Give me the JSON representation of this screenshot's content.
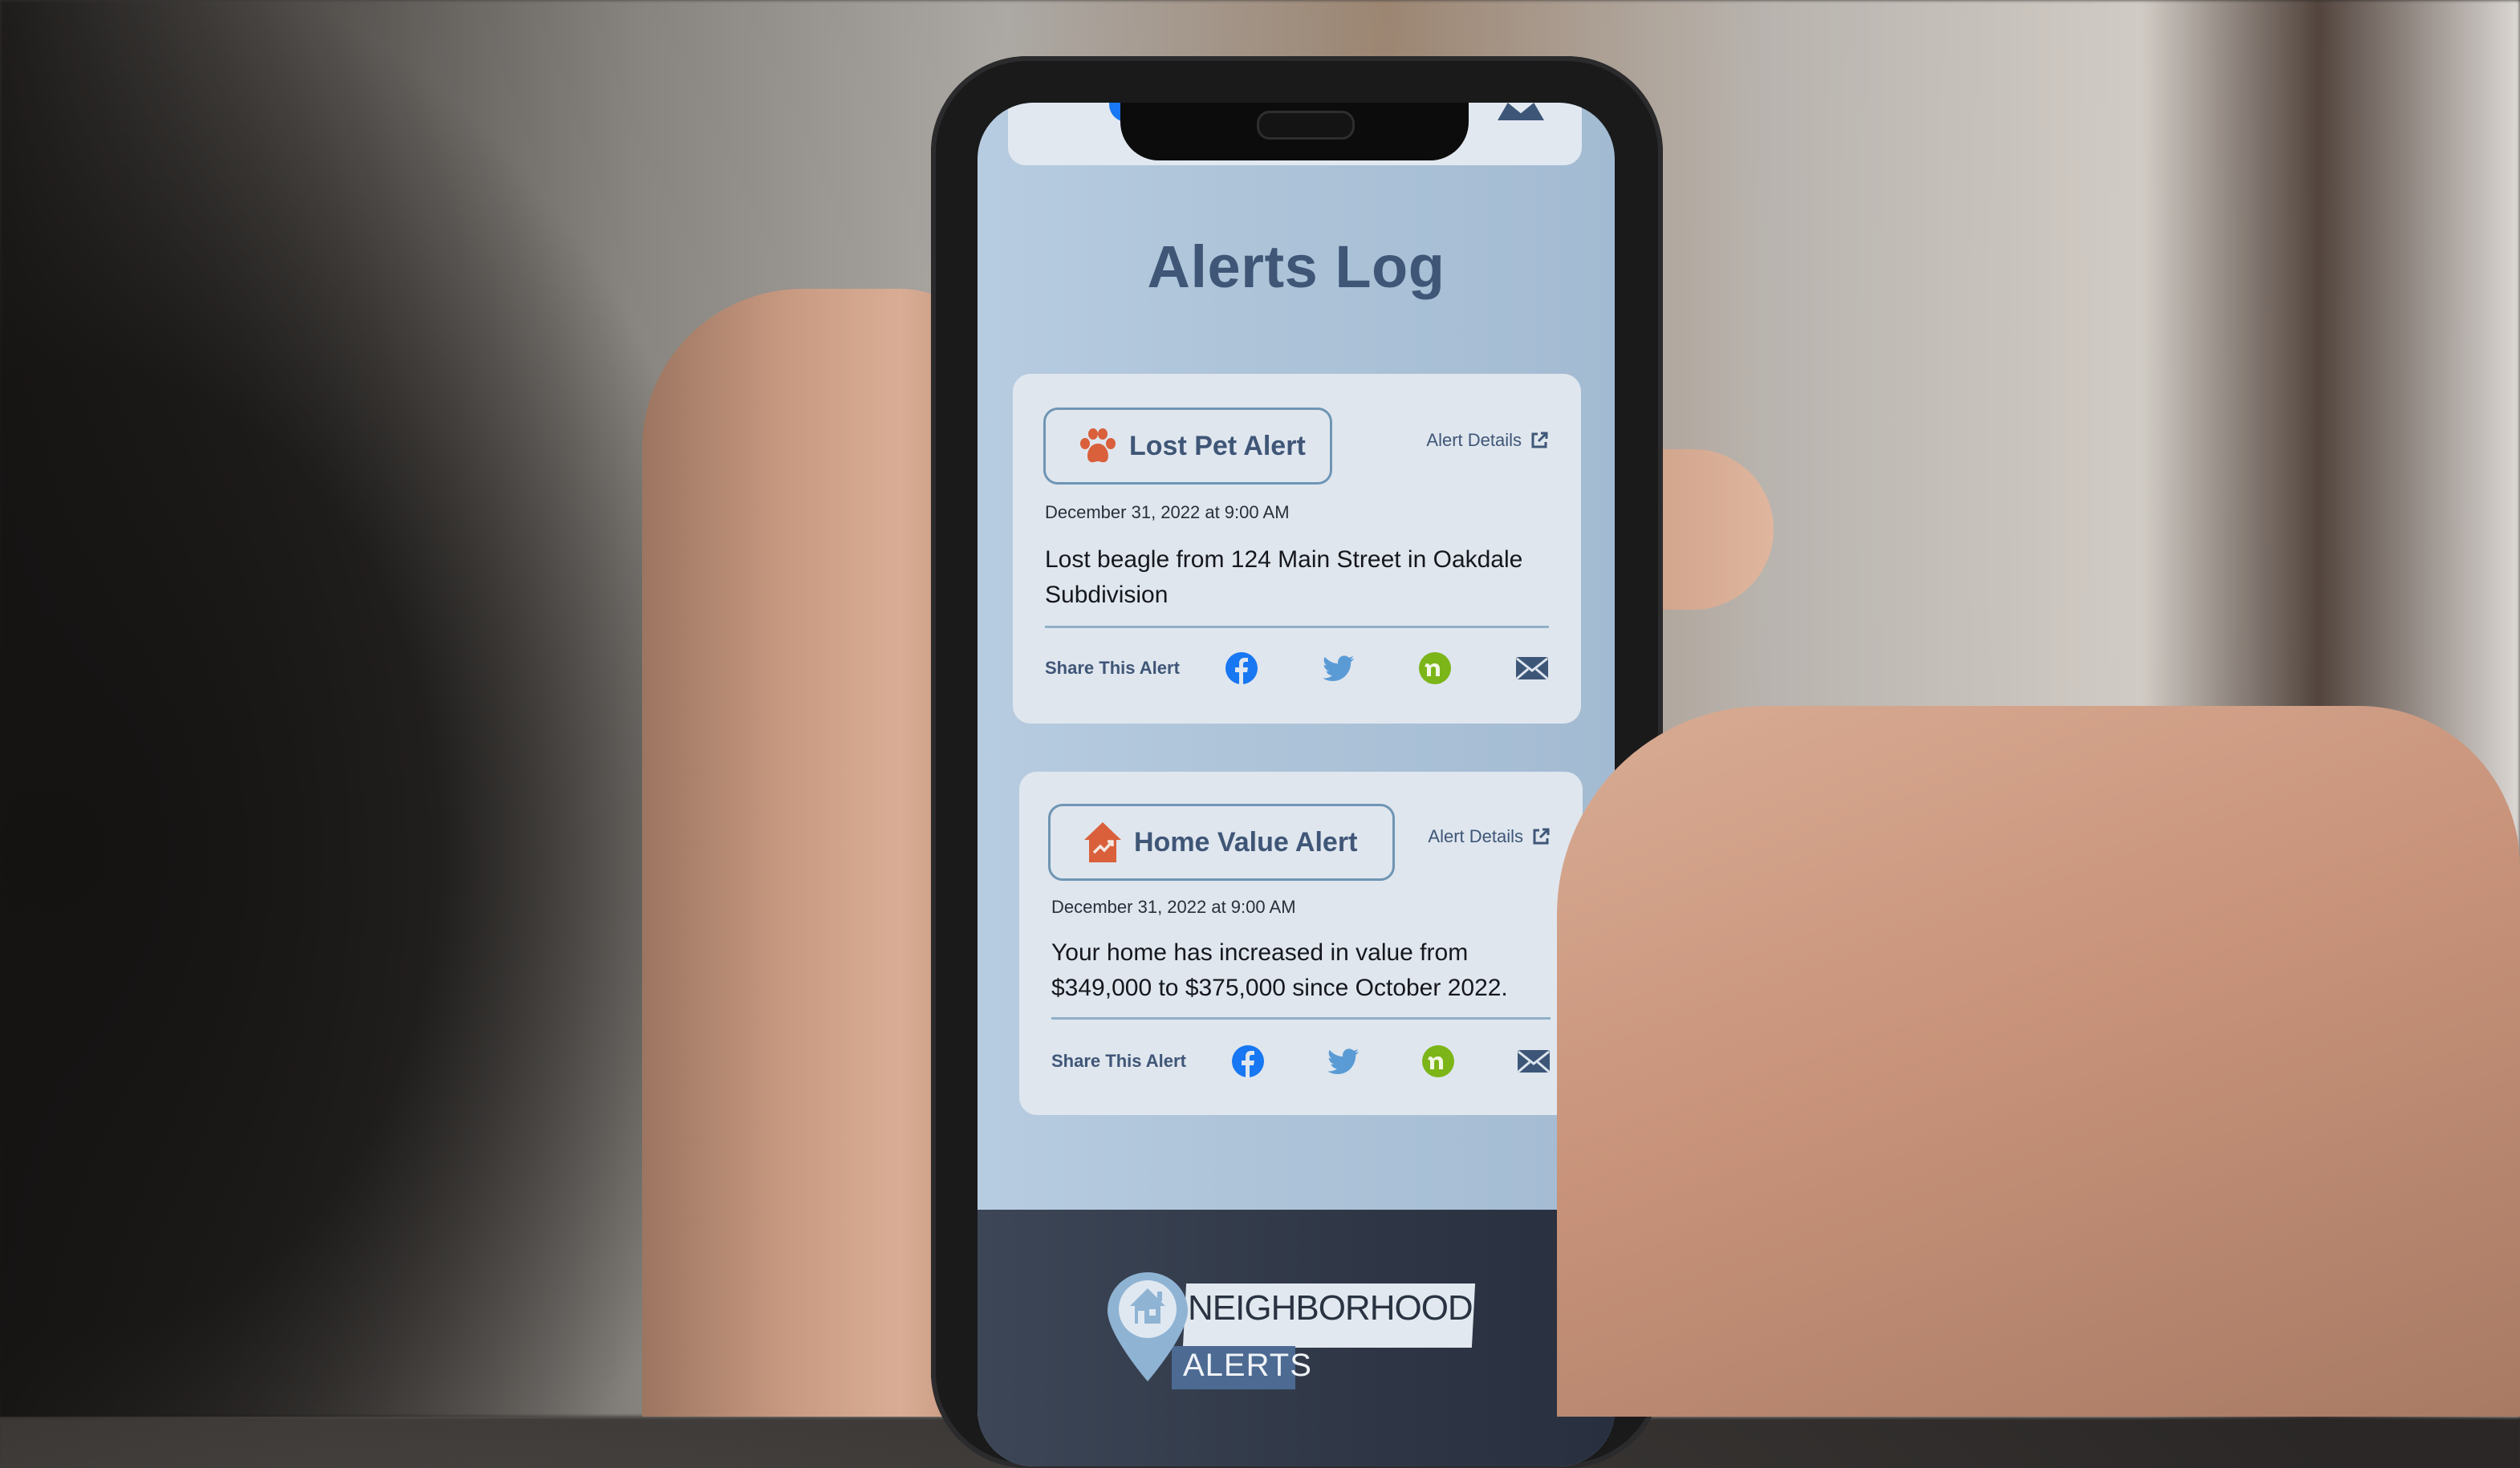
{
  "page": {
    "title": "Alerts Log"
  },
  "alerts": [
    {
      "type_label": "Lost Pet Alert",
      "icon": "paw-icon",
      "details_label": "Alert Details",
      "date": "December 31, 2022 at 9:00 AM",
      "message": "Lost beagle from 124 Main Street in Oakdale Subdivision",
      "share_label": "Share This Alert"
    },
    {
      "type_label": "Home Value Alert",
      "icon": "house-trend-icon",
      "details_label": "Alert Details",
      "date": "December 31, 2022 at 9:00 AM",
      "message": "Your home has increased in value from $349,000 to $375,000 since October 2022.",
      "share_label": "Share This Alert"
    }
  ],
  "share_targets": [
    "facebook",
    "twitter",
    "nextdoor",
    "email"
  ],
  "footer": {
    "logo_line1": "NEIGHBORHOOD",
    "logo_line2": "ALERTS"
  },
  "colors": {
    "accent_orange": "#d9603b",
    "heading_blue": "#3f5677",
    "screen_bg": "#aec4d9",
    "card_bg": "#dfe6ee",
    "facebook": "#1877f2",
    "twitter": "#5a9bd5",
    "nextdoor": "#7cb518",
    "email": "#3d5678",
    "footer_bg": "#2f3746"
  }
}
